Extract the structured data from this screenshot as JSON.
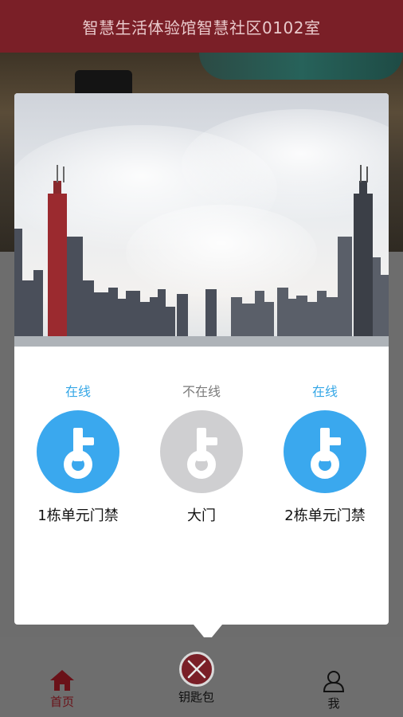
{
  "header": {
    "title": "智慧生活体验馆智慧社区0102室"
  },
  "doors": [
    {
      "status": "在线",
      "name": "1栋单元门禁",
      "online": true
    },
    {
      "status": "不在线",
      "name": "大门",
      "online": false
    },
    {
      "status": "在线",
      "name": "2栋单元门禁",
      "online": true
    }
  ],
  "tabs": {
    "home": {
      "label": "首页",
      "icon": "home-icon"
    },
    "keys": {
      "label": "钥匙包",
      "icon": "close-icon"
    },
    "me": {
      "label": "我",
      "icon": "user-icon"
    }
  },
  "colors": {
    "brand": "#7a1f27",
    "online": "#3aa8ee",
    "offline": "#cfcfd1"
  }
}
